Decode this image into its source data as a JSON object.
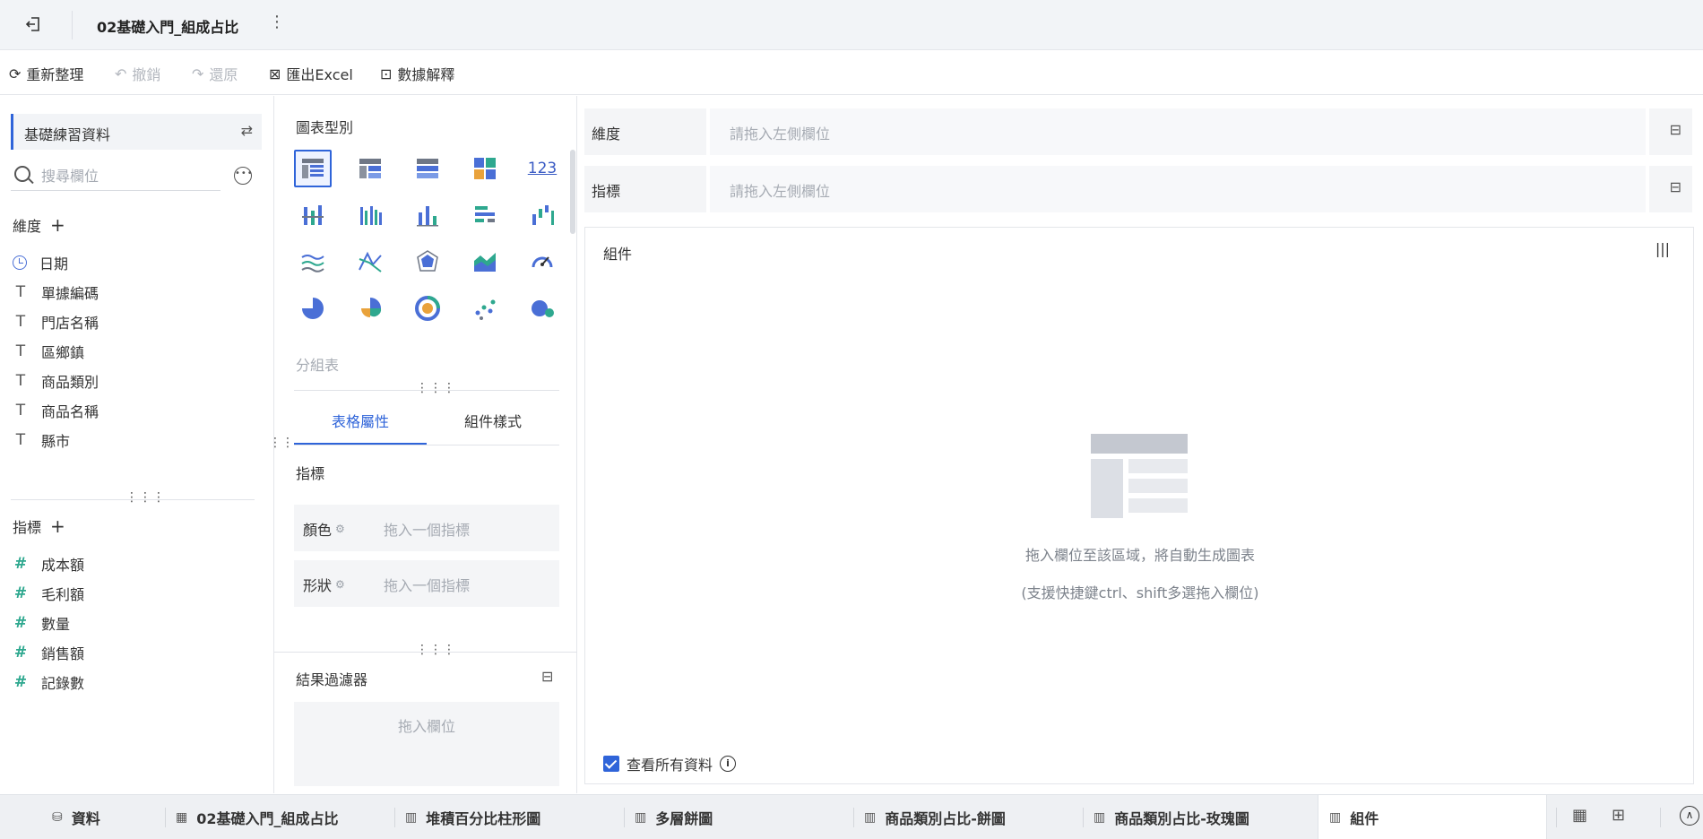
{
  "header": {
    "title": "02基礎入門_組成占比",
    "back_icon": "exit-icon",
    "more_icon": "kebab-icon"
  },
  "toolbar": {
    "refresh": "重新整理",
    "undo": "撤銷",
    "redo": "還原",
    "export": "匯出Excel",
    "explain": "數據解釋"
  },
  "left": {
    "dataset": "基礎練習資料",
    "search_placeholder": "搜尋欄位",
    "dimensions_title": "維度",
    "dimensions": [
      {
        "label": "日期",
        "icon": "clock-icon"
      },
      {
        "label": "單據編碼",
        "icon": "text-icon"
      },
      {
        "label": "門店名稱",
        "icon": "text-icon"
      },
      {
        "label": "區鄉鎮",
        "icon": "text-icon"
      },
      {
        "label": "商品類別",
        "icon": "text-icon"
      },
      {
        "label": "商品名稱",
        "icon": "text-icon"
      },
      {
        "label": "縣市",
        "icon": "text-icon"
      }
    ],
    "metrics_title": "指標",
    "metrics": [
      {
        "label": "成本額",
        "icon": "hash-icon"
      },
      {
        "label": "毛利額",
        "icon": "hash-icon"
      },
      {
        "label": "數量",
        "icon": "hash-icon"
      },
      {
        "label": "銷售額",
        "icon": "hash-icon"
      },
      {
        "label": "記錄數",
        "icon": "hash-icon"
      }
    ]
  },
  "middle": {
    "chart_type_title": "圖表型別",
    "selected_type": "分組表",
    "tabs": [
      "表格屬性",
      "組件樣式"
    ],
    "metrics_label": "指標",
    "color_label": "顏色",
    "color_placeholder": "拖入一個指標",
    "shape_label": "形狀",
    "shape_placeholder": "拖入一個指標",
    "filter_title": "結果過濾器",
    "filter_placeholder": "拖入欄位",
    "number_tile": "123"
  },
  "right": {
    "dim_label": "維度",
    "dim_placeholder": "請拖入左側欄位",
    "metric_label": "指標",
    "metric_placeholder": "請拖入左側欄位",
    "canvas_title": "組件",
    "empty_text": "拖入欄位至該區域，將自動生成圖表",
    "empty_hint": "(支援快捷鍵ctrl、shift多選拖入欄位)",
    "view_all": "查看所有資料"
  },
  "bottom": {
    "data": "資料",
    "tabs": [
      "02基礎入門_組成占比",
      "堆積百分比柱形圖",
      "多層餅圖",
      "商品類別占比-餅圖",
      "商品類別占比-玫瑰圖",
      "組件"
    ]
  },
  "colors": {
    "accent": "#2f64d9",
    "teal": "#2ea88f"
  }
}
